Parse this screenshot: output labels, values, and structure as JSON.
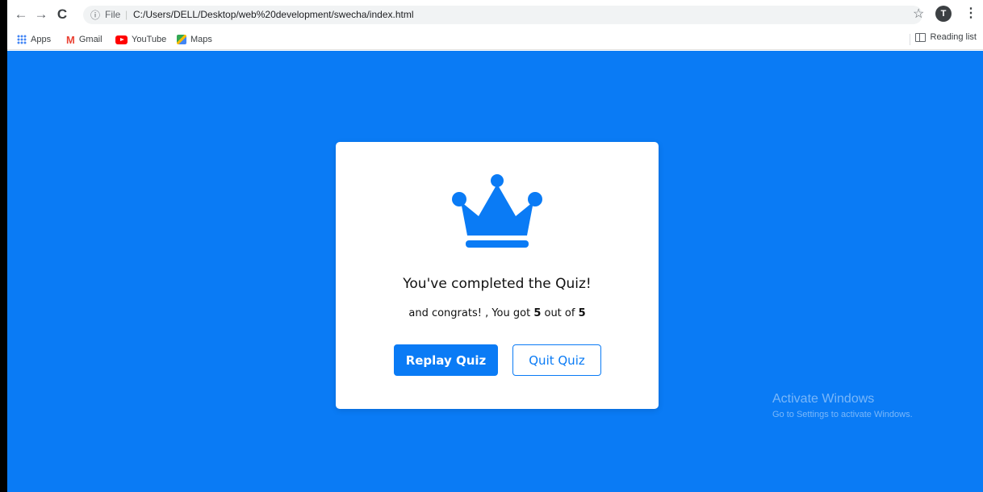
{
  "browser": {
    "back_glyph": "←",
    "forward_glyph": "→",
    "reload_glyph": "C",
    "info_glyph": "ⓘ",
    "file_label": "File",
    "separator": "|",
    "url": "C:/Users/DELL/Desktop/web%20development/swecha/index.html",
    "star_glyph": "☆",
    "profile_initial": "T",
    "menu_glyph": "⋮"
  },
  "bookmarks": {
    "items": [
      {
        "label": "Apps",
        "icon": "apps-icon"
      },
      {
        "label": "Gmail",
        "icon": "gmail-icon"
      },
      {
        "label": "YouTube",
        "icon": "youtube-icon"
      },
      {
        "label": "Maps",
        "icon": "maps-icon"
      }
    ],
    "gmail_glyph": "M",
    "reading_list": "Reading list"
  },
  "quiz_result": {
    "heading": "You've completed the Quiz!",
    "score_prefix": "and congrats! , You got ",
    "score_got": "5",
    "score_middle": " out of ",
    "score_total": "5",
    "replay_label": "Replay Quiz",
    "quit_label": "Quit Quiz"
  },
  "watermark": {
    "title": "Activate Windows",
    "subtitle": "Go to Settings to activate Windows."
  },
  "colors": {
    "accent": "#0a7bf5",
    "page_background": "#0a7bf5",
    "card_background": "#ffffff"
  }
}
